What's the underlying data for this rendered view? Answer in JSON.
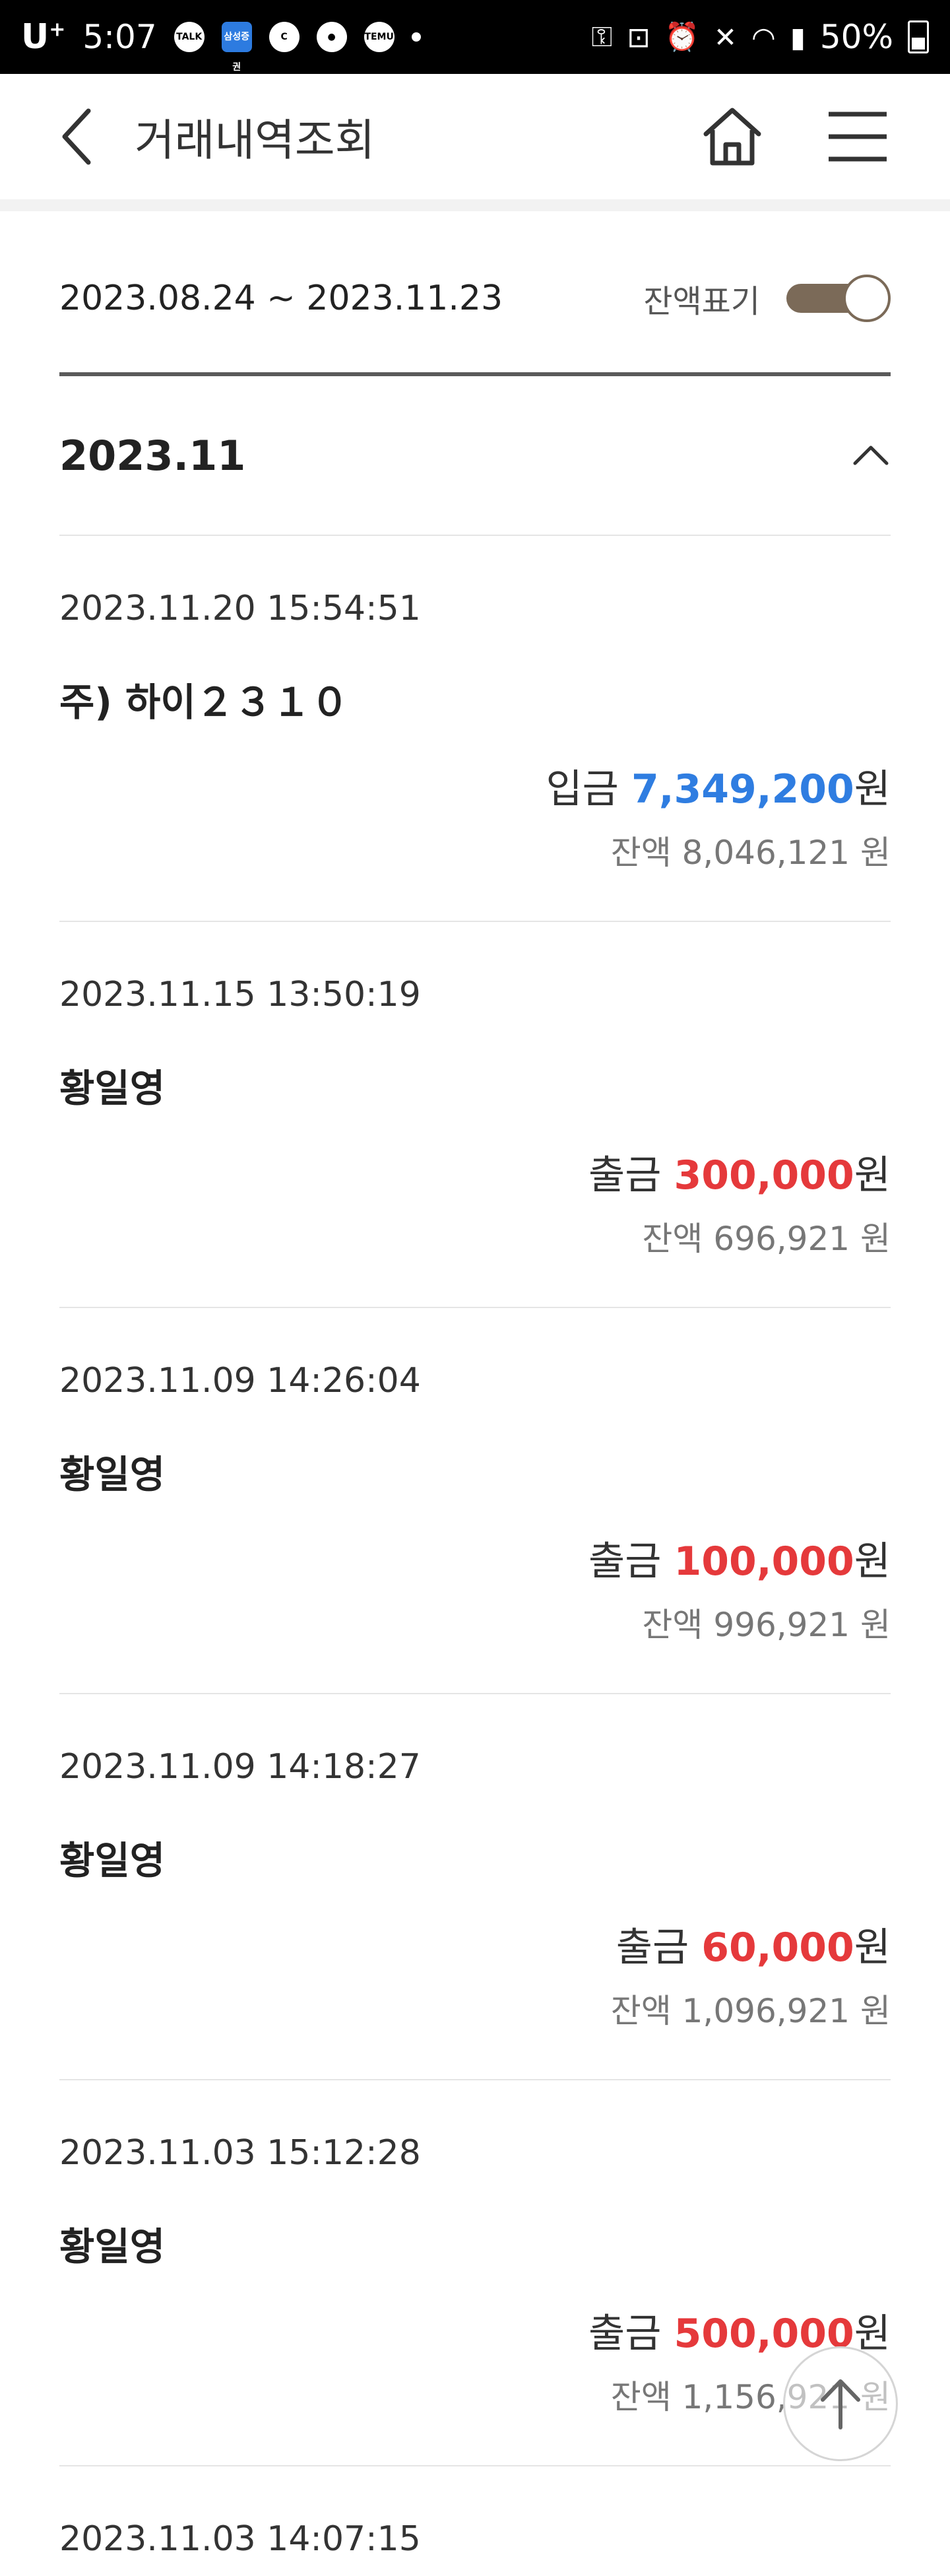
{
  "status_bar": {
    "carrier": "U",
    "carrier_sup": "+",
    "time": "5:07",
    "app_icons": [
      "TALK",
      "삼성증권",
      "C",
      "chat",
      "TEMU"
    ],
    "battery": "50%"
  },
  "header": {
    "title": "거래내역조회",
    "back_icon": "chevron-left-icon",
    "home_icon": "home-icon",
    "menu_icon": "hamburger-menu-icon"
  },
  "filter": {
    "period": "2023.08.24 ~ 2023.11.23",
    "balance_toggle_label": "잔액표기",
    "balance_toggle_on": true,
    "toggle_color": "#7b6a58"
  },
  "month_group": {
    "label": "2023.11",
    "expanded": true
  },
  "currency_unit": "원",
  "colors": {
    "deposit": "#2f7de1",
    "withdraw": "#e5393b"
  },
  "transactions": [
    {
      "datetime": "2023.11.20 15:54:51",
      "name": "주) 하이２３１０",
      "type_label": "입금",
      "type": "deposit",
      "amount": "7,349,200",
      "balance_label": "잔액",
      "balance": "8,046,121"
    },
    {
      "datetime": "2023.11.15 13:50:19",
      "name": "황일영",
      "type_label": "출금",
      "type": "withdraw",
      "amount": "300,000",
      "balance_label": "잔액",
      "balance": "696,921"
    },
    {
      "datetime": "2023.11.09 14:26:04",
      "name": "황일영",
      "type_label": "출금",
      "type": "withdraw",
      "amount": "100,000",
      "balance_label": "잔액",
      "balance": "996,921"
    },
    {
      "datetime": "2023.11.09 14:18:27",
      "name": "황일영",
      "type_label": "출금",
      "type": "withdraw",
      "amount": "60,000",
      "balance_label": "잔액",
      "balance": "1,096,921"
    },
    {
      "datetime": "2023.11.03 15:12:28",
      "name": "황일영",
      "type_label": "출금",
      "type": "withdraw",
      "amount": "500,000",
      "balance_label": "잔액",
      "balance": "1,156,921"
    },
    {
      "datetime": "2023.11.03 14:07:15"
    }
  ],
  "scroll_top_icon": "arrow-up-icon"
}
